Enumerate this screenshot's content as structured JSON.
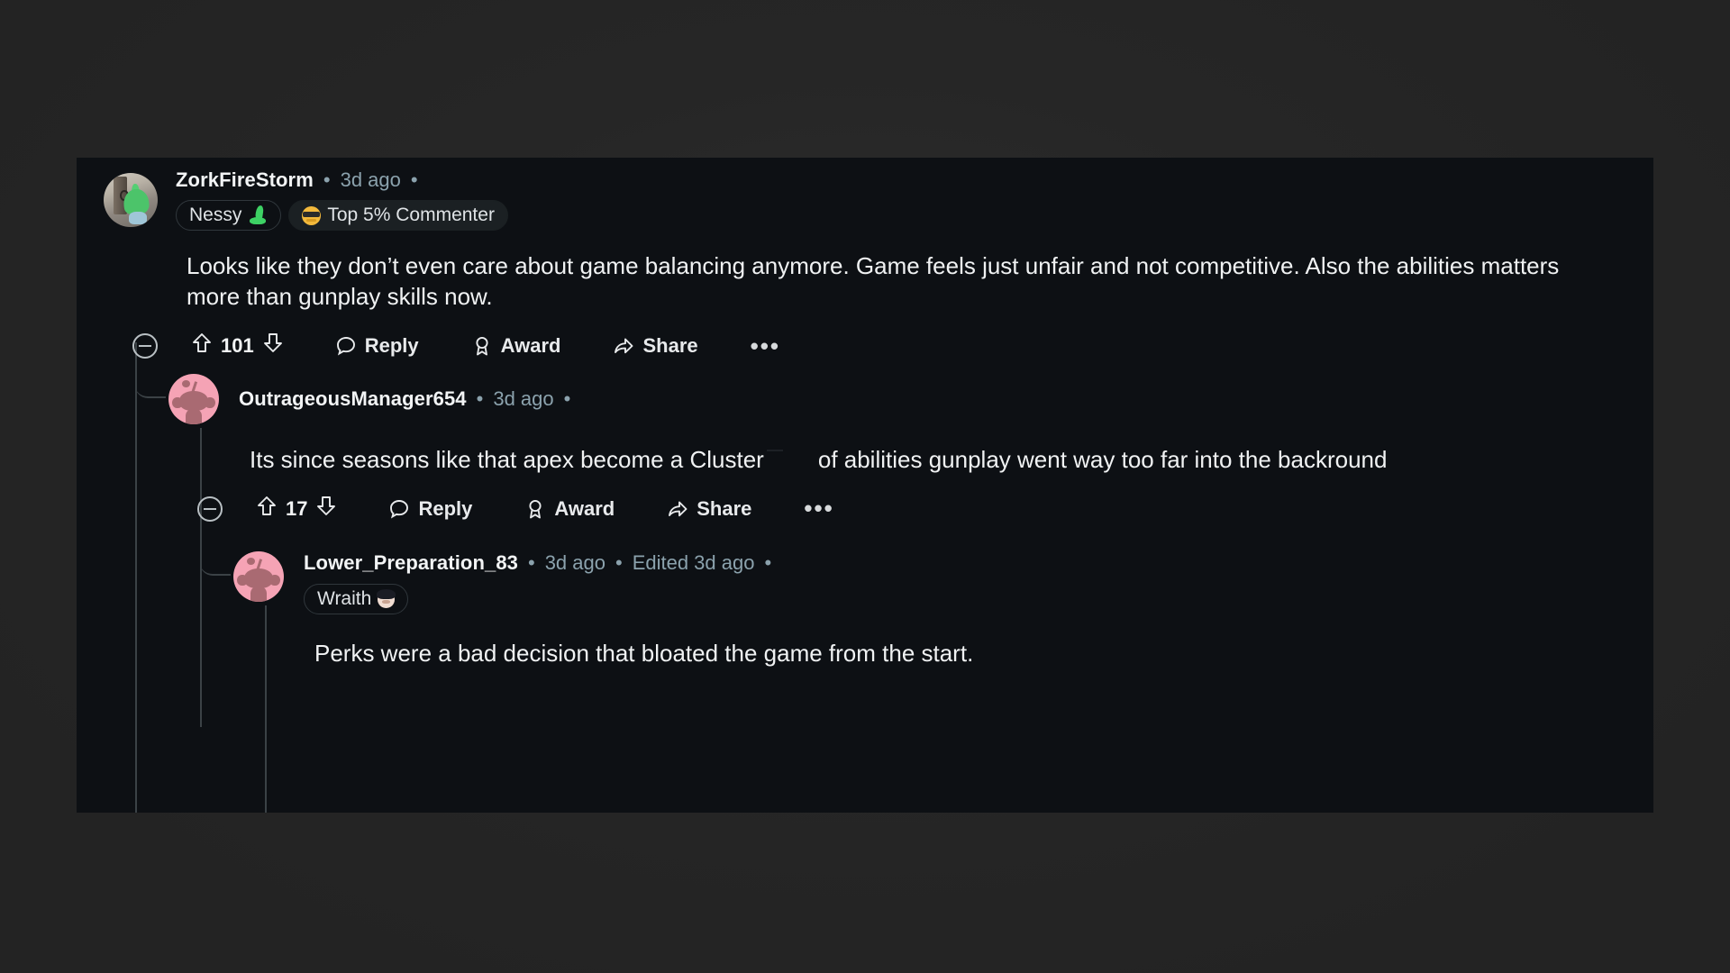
{
  "page": {
    "background_color": "#262626",
    "card_color": "#0d1014",
    "thread_line_color": "#3b4246"
  },
  "comments": [
    {
      "id": "comment-1",
      "depth": 0,
      "avatar": {
        "type": "photo-nessy",
        "name": "user-avatar-zorkfirestorm"
      },
      "username": "ZorkFireStorm",
      "meta_dot_1": "•",
      "timestamp": "3d ago",
      "meta_dot_2": "•",
      "badges": [
        {
          "label": "Nessy",
          "icon": "nessy-emoji",
          "style": "outline"
        },
        {
          "label": "Top 5% Commenter",
          "icon": "sunglasses-emoji",
          "style": "filled"
        }
      ],
      "body": "Looks like they don’t even care about game balancing anymore. Game feels just unfair and not competitive. Also the abilities matters more than gunplay skills now.",
      "actions": {
        "collapse": "collapse-thread",
        "upvote": "upvote",
        "score": "101",
        "downvote": "downvote",
        "reply": "Reply",
        "award": "Award",
        "share": "Share",
        "more": "•••"
      }
    },
    {
      "id": "comment-2",
      "depth": 1,
      "avatar": {
        "type": "snoo-pink",
        "name": "user-avatar-outrageousmanager654"
      },
      "username": "OutrageousManager654",
      "meta_dot_1": "•",
      "timestamp": "3d ago",
      "meta_dot_2": "•",
      "badges": [],
      "body_part_1": "Its since seasons like that apex become a Cluster",
      "body_redacted": true,
      "body_part_2": "of abilities gunplay went way too far into the backround",
      "actions": {
        "collapse": "collapse-thread",
        "upvote": "upvote",
        "score": "17",
        "downvote": "downvote",
        "reply": "Reply",
        "award": "Award",
        "share": "Share",
        "more": "•••"
      }
    },
    {
      "id": "comment-3",
      "depth": 2,
      "avatar": {
        "type": "snoo-pink",
        "name": "user-avatar-lower-preparation-83"
      },
      "username": "Lower_Preparation_83",
      "meta_dot_1": "•",
      "timestamp": "3d ago",
      "meta_dot_2": "•",
      "edited": "Edited 3d ago",
      "meta_dot_3": "•",
      "badges": [
        {
          "label": "Wraith",
          "icon": "wraith-emoji",
          "style": "outline"
        }
      ],
      "body": "Perks were a bad decision that bloated the game from the start."
    }
  ]
}
